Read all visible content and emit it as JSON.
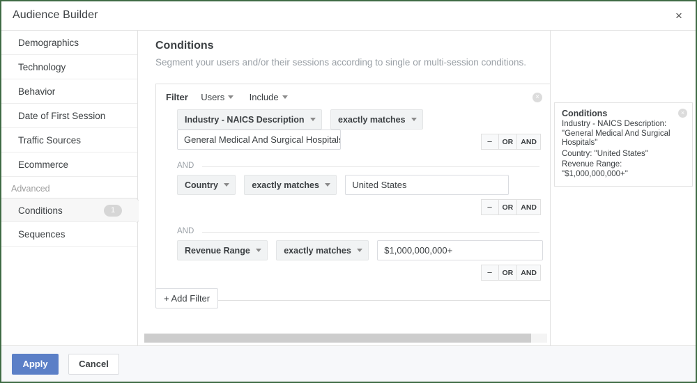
{
  "window": {
    "title": "Audience Builder",
    "close_icon": "close-icon",
    "close_glyph": "×",
    "border_color": "#3f6b44"
  },
  "sidebar": {
    "items": [
      {
        "label": "Demographics",
        "selected": false
      },
      {
        "label": "Technology",
        "selected": false
      },
      {
        "label": "Behavior",
        "selected": false
      },
      {
        "label": "Date of First Session",
        "selected": false
      },
      {
        "label": "Traffic Sources",
        "selected": false
      },
      {
        "label": "Ecommerce",
        "selected": false
      }
    ],
    "group_label": "Advanced",
    "advanced_items": [
      {
        "label": "Conditions",
        "selected": true,
        "badge": "1"
      },
      {
        "label": "Sequences",
        "selected": false,
        "badge": ""
      }
    ]
  },
  "main": {
    "title": "Conditions",
    "subtitle": "Segment your users and/or their sessions according to single or multi-session conditions.",
    "filter": {
      "label": "Filter",
      "scope": "Users",
      "mode": "Include",
      "remove_icon": "remove-circle-icon",
      "remove_glyph": "×"
    },
    "conditions": [
      {
        "dimension": "Industry - NAICS Description",
        "operator": "exactly matches",
        "value": "General Medical And Surgical Hospitals",
        "value_width": "235px",
        "separator": ""
      },
      {
        "dimension": "Country",
        "operator": "exactly matches",
        "value": "United States",
        "value_width": "235px",
        "separator": "AND"
      },
      {
        "dimension": "Revenue Range",
        "operator": "exactly matches",
        "value": "$1,000,000,000+",
        "value_width": "238px",
        "separator": "AND"
      }
    ],
    "row_buttons": {
      "minus": "−",
      "or": "OR",
      "and": "AND"
    },
    "add_filter_label": "+ Add Filter"
  },
  "summary": {
    "title": "Conditions",
    "lines": [
      "Industry - NAICS Description: \"General Medical And Surgical Hospitals\"",
      "Country: \"United States\"",
      "Revenue Range: \"$1,000,000,000+\""
    ],
    "remove_icon": "remove-circle-icon",
    "remove_glyph": "×"
  },
  "footer": {
    "apply_label": "Apply",
    "cancel_label": "Cancel",
    "apply_color": "#5b7fc7"
  }
}
